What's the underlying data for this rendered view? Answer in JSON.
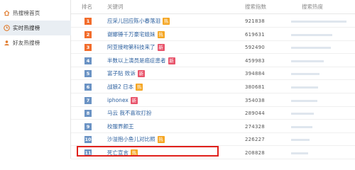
{
  "sidebar": {
    "items": [
      {
        "label": "热搜榜首页",
        "icon": "home-icon"
      },
      {
        "label": "实时热搜榜",
        "icon": "trend-icon",
        "active": true
      },
      {
        "label": "好友热搜榜",
        "icon": "friends-icon"
      }
    ]
  },
  "table": {
    "headers": {
      "rank": "排名",
      "keyword": "关键词",
      "index": "搜索指数",
      "heat": "搜索热度"
    },
    "rows": [
      {
        "rank": "1",
        "keyword": "应采儿回应陈小春落泪",
        "tag": "热",
        "tag_color": "#f5a623",
        "index": "921838",
        "heat_fraction": 0.98
      },
      {
        "rank": "2",
        "keyword": "谢娜锤千万豪宅姐妹",
        "tag": "热",
        "tag_color": "#f5a623",
        "index": "619631",
        "heat_fraction": 0.72
      },
      {
        "rank": "3",
        "keyword": "阿亚接吻第科技来了",
        "tag": "新",
        "tag_color": "#e8546b",
        "index": "592490",
        "heat_fraction": 0.7
      },
      {
        "rank": "4",
        "keyword": "半数以上演员是癌症患者",
        "tag": "新",
        "tag_color": "#e8546b",
        "index": "459983",
        "heat_fraction": 0.58
      },
      {
        "rank": "5",
        "keyword": "富子贴 败诉",
        "tag": "新",
        "tag_color": "#e8546b",
        "index": "394884",
        "heat_fraction": 0.5
      },
      {
        "rank": "6",
        "keyword": "战狼2 日本",
        "tag": "热",
        "tag_color": "#f5a623",
        "index": "380681",
        "heat_fraction": 0.48
      },
      {
        "rank": "7",
        "keyword": "iphonex",
        "tag": "新",
        "tag_color": "#e8546b",
        "index": "354038",
        "heat_fraction": 0.46
      },
      {
        "rank": "8",
        "keyword": "马云 我不喜欢打扮",
        "tag": "",
        "tag_color": "",
        "index": "289044",
        "heat_fraction": 0.4
      },
      {
        "rank": "9",
        "keyword": "校服界颜王",
        "tag": "",
        "tag_color": "",
        "index": "274328",
        "heat_fraction": 0.38
      },
      {
        "rank": "10",
        "keyword": "沙溢抱小鱼儿对比照",
        "tag": "热",
        "tag_color": "#f5a623",
        "index": "226227",
        "heat_fraction": 0.32
      },
      {
        "rank": "11",
        "keyword": "死亡宣言",
        "tag": "热",
        "tag_color": "#f5a623",
        "index": "208828",
        "heat_fraction": 0.3
      }
    ]
  },
  "colors": {
    "rank_top": "#f26c2b",
    "rank_other": "#6b93c4",
    "highlight": "#e0201b"
  }
}
